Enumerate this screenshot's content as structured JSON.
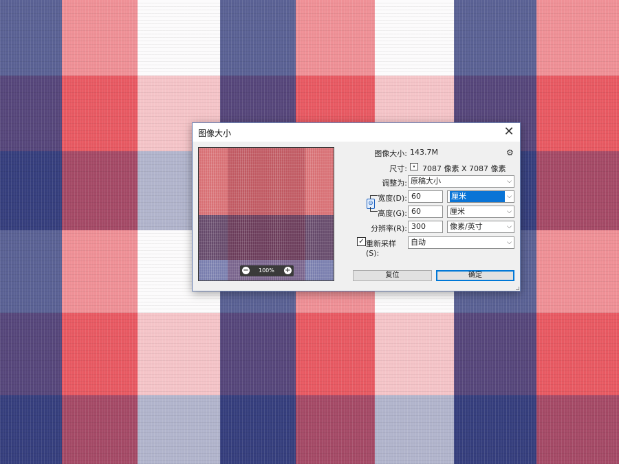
{
  "dialog": {
    "title": "图像大小",
    "close_glyph": "✕"
  },
  "preview": {
    "zoom_out_glyph": "−",
    "zoom_in_glyph": "+",
    "zoom_level": "100%"
  },
  "info": {
    "image_size_label": "图像大小:",
    "image_size_value": "143.7M",
    "settings_icon": "gear-icon",
    "dimensions_label": "尺寸:",
    "dimensions_value": "7087 像素 X 7087 像素"
  },
  "fit_to": {
    "label": "调整为:",
    "value": "原稿大小"
  },
  "width": {
    "label": "宽度(D):",
    "value": "60",
    "unit": "厘米"
  },
  "height": {
    "label": "高度(G):",
    "value": "60",
    "unit": "厘米"
  },
  "resolution": {
    "label": "分辨率(R):",
    "value": "300",
    "unit": "像素/英寸"
  },
  "resample": {
    "label": "重新采样(S):",
    "checked": true,
    "check_glyph": "✓",
    "value": "自动"
  },
  "buttons": {
    "reset": "复位",
    "ok": "确定"
  },
  "glyphs": {
    "dropdown_arrow": "⌵",
    "mini_arrow": "▾",
    "link": "⊖",
    "gear": "⚙"
  }
}
